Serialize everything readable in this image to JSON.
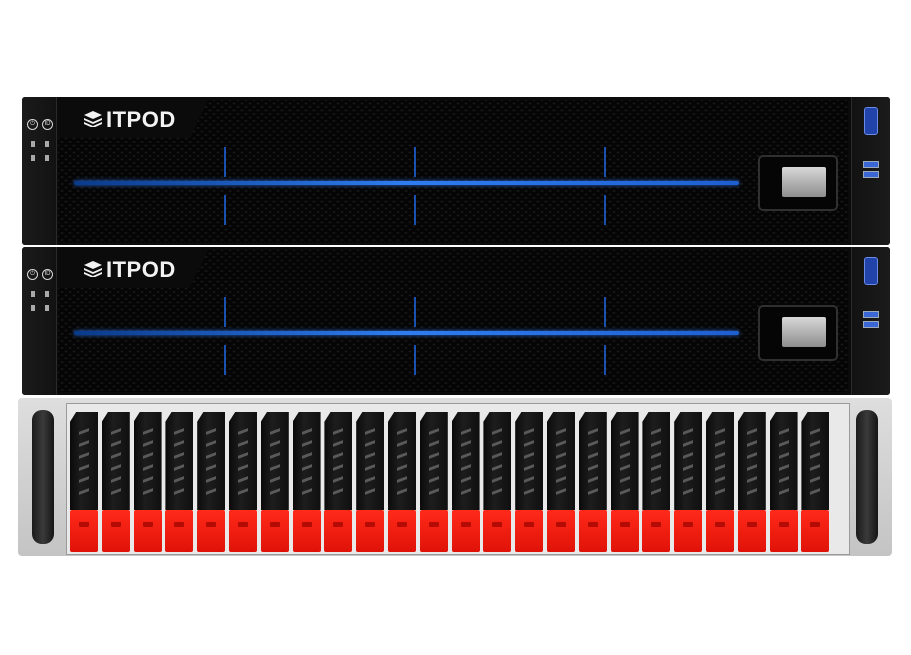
{
  "servers": [
    {
      "brand": "ITPOD"
    },
    {
      "brand": "ITPOD"
    }
  ],
  "ear": {
    "power_glyph": "⏻",
    "id_glyph": "ID"
  },
  "storage": {
    "bay_count": 24
  },
  "colors": {
    "accent_blue": "#2f7df0",
    "tray_red": "#ff2a1a",
    "chassis_black": "#0b0b0c",
    "chassis_silver": "#dedede"
  },
  "icons": [
    "power-icon",
    "id-icon",
    "logo-icon",
    "vga-port-icon",
    "usb-port-icon"
  ]
}
